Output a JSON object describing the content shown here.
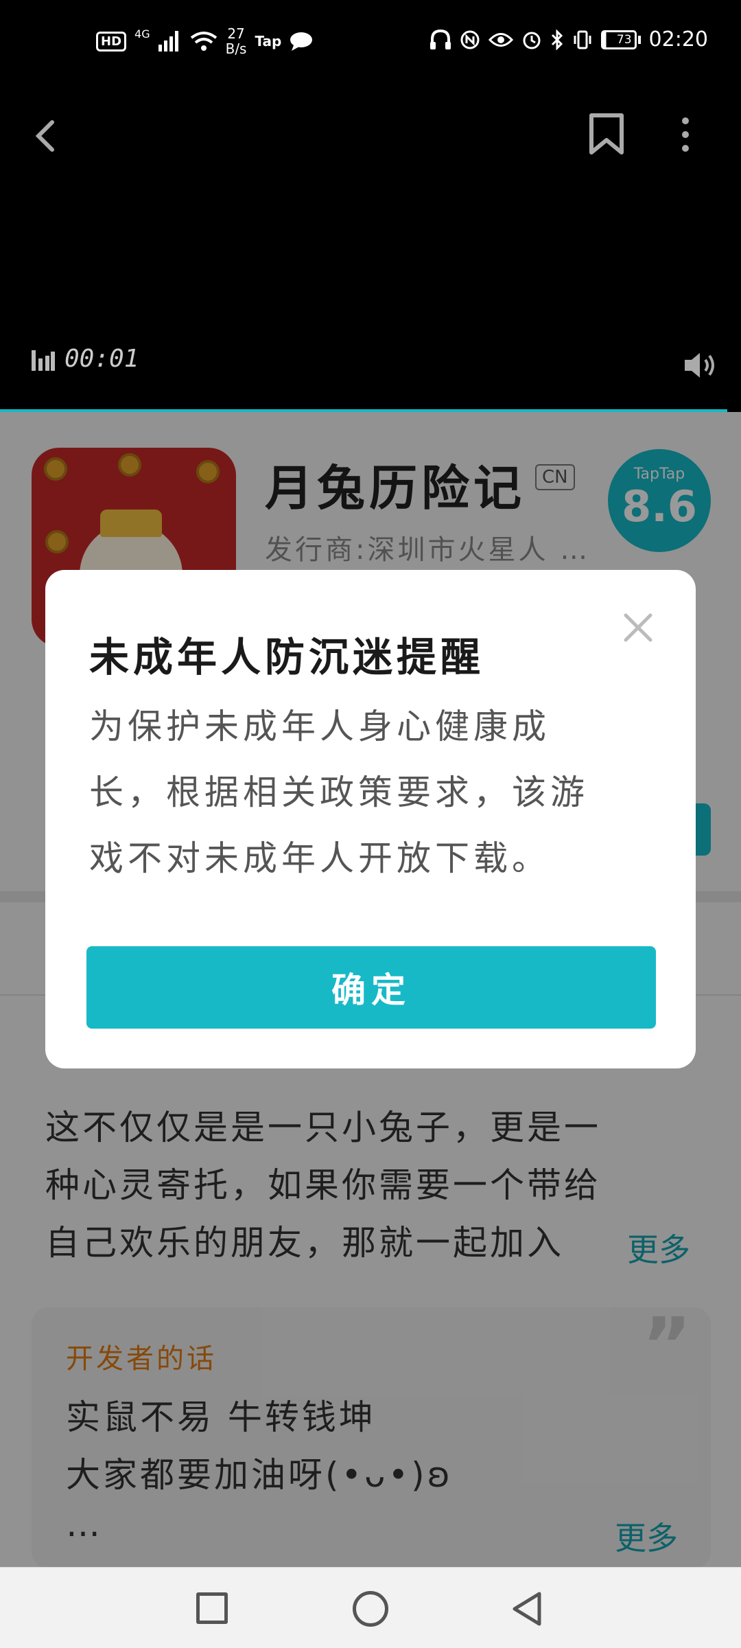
{
  "status_bar": {
    "hd": "HD",
    "network": "4G",
    "speed_value": "27",
    "speed_unit": "B/s",
    "app_tag": "Tap",
    "battery": "73",
    "time": "02:20"
  },
  "video": {
    "elapsed": "00:01"
  },
  "game": {
    "title": "月兔历险记",
    "region_badge": "CN",
    "publisher": "发行商:深圳市火星人 …",
    "rating_source": "TapTap",
    "rating": "8.6"
  },
  "description": {
    "lines": [
      "这不仅仅是是一只小兔子，更是一",
      "种心灵寄托，如果你需要一个带给",
      "自己欢乐的朋友，那就一起加入"
    ],
    "more": "更多"
  },
  "developer_note": {
    "title": "开发者的话",
    "lines": [
      "实鼠不易 牛转钱坤",
      "大家都要加油呀(•ᴗ•)ʚ",
      "…"
    ],
    "more": "更多"
  },
  "modal": {
    "title": "未成年人防沉迷提醒",
    "body_lines": [
      "为保护未成年人身心健康成",
      "长，根据相关政策要求，该游",
      "戏不对未成年人开放下载。"
    ],
    "confirm": "确定"
  },
  "colors": {
    "accent": "#17b9c7",
    "developer_title": "#e07a12"
  }
}
